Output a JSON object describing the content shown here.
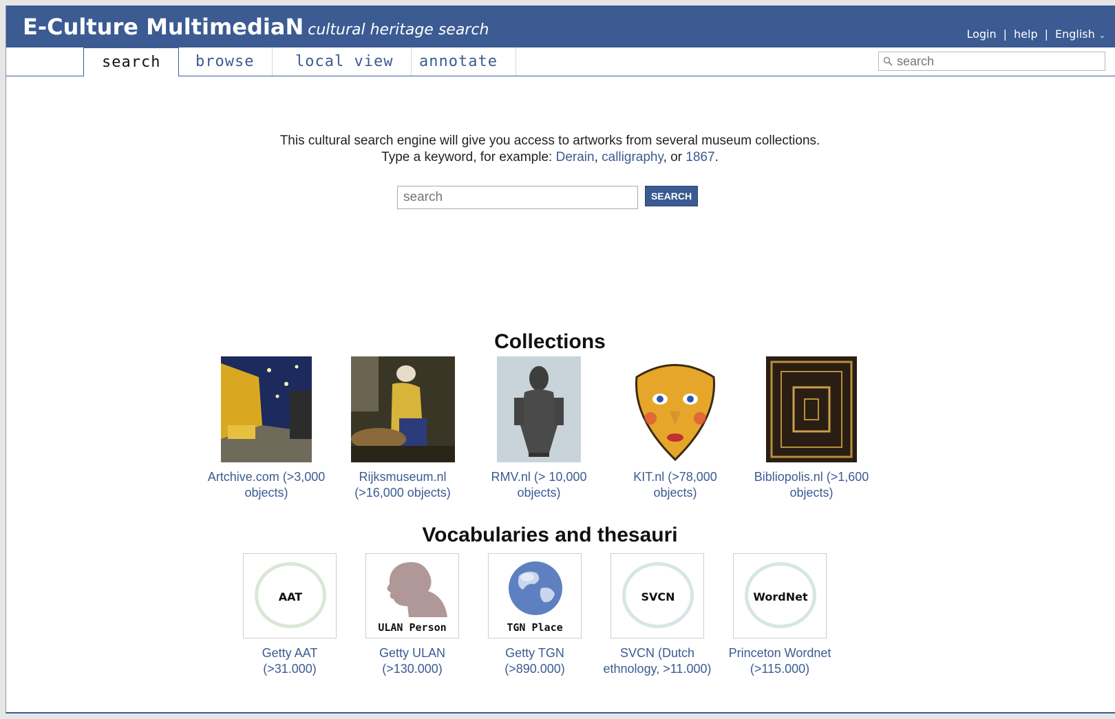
{
  "header": {
    "brand": "E-Culture MultimediaN",
    "tagline": "cultural heritage search",
    "login": "Login",
    "help": "help",
    "language": "English",
    "separator": "|"
  },
  "tabs": [
    {
      "label": "search",
      "active": true
    },
    {
      "label": "browse",
      "active": false
    },
    {
      "label": "local view",
      "active": false
    },
    {
      "label": "annotate",
      "active": false
    }
  ],
  "top_search": {
    "placeholder": "search"
  },
  "intro": {
    "line1": "This cultural search engine will give you access to artworks from several museum collections.",
    "line2_prefix": "Type a keyword, for example:",
    "examples": [
      "Derain",
      "calligraphy",
      "1867"
    ],
    "comma": ",",
    "or": ", or",
    "period": "."
  },
  "main_search": {
    "placeholder": "search",
    "button": "SEARCH"
  },
  "collections": {
    "title": "Collections",
    "items": [
      {
        "line1": "Artchive.com (>3,000",
        "line2": "objects)",
        "icon": "cafe-terrace-painting"
      },
      {
        "line1": "Rijksmuseum.nl",
        "line2": "(>16,000 objects)",
        "icon": "milkmaid-painting"
      },
      {
        "line1": "RMV.nl (> 10,000",
        "line2": "objects)",
        "icon": "stone-statue"
      },
      {
        "line1": "KIT.nl (>78,000",
        "line2": "objects)",
        "icon": "mask"
      },
      {
        "line1": "Bibliopolis.nl (>1,600",
        "line2": "objects)",
        "icon": "ornate-book-cover"
      }
    ]
  },
  "vocabularies": {
    "title": "Vocabularies and thesauri",
    "items": [
      {
        "badge": "AAT",
        "line1": "Getty AAT",
        "line2": "(>31.000)",
        "ring_color": "#dbe7d6"
      },
      {
        "badge": "ULAN Person",
        "line1": "Getty ULAN",
        "line2": "(>130.000)",
        "icon": "person-silhouette"
      },
      {
        "badge": "TGN Place",
        "line1": "Getty TGN",
        "line2": "(>890.000)",
        "icon": "globe"
      },
      {
        "badge": "SVCN",
        "line1": "SVCN (Dutch",
        "line2": "ethnology, >11.000)",
        "ring_color": "#d6e6e6"
      },
      {
        "badge": "WordNet",
        "line1": "Princeton Wordnet",
        "line2": "(>115.000)",
        "ring_color": "#d6e6e6"
      }
    ]
  },
  "colors": {
    "accent": "#3b5b92",
    "link": "#3b5b92",
    "background": "#ffffff"
  }
}
